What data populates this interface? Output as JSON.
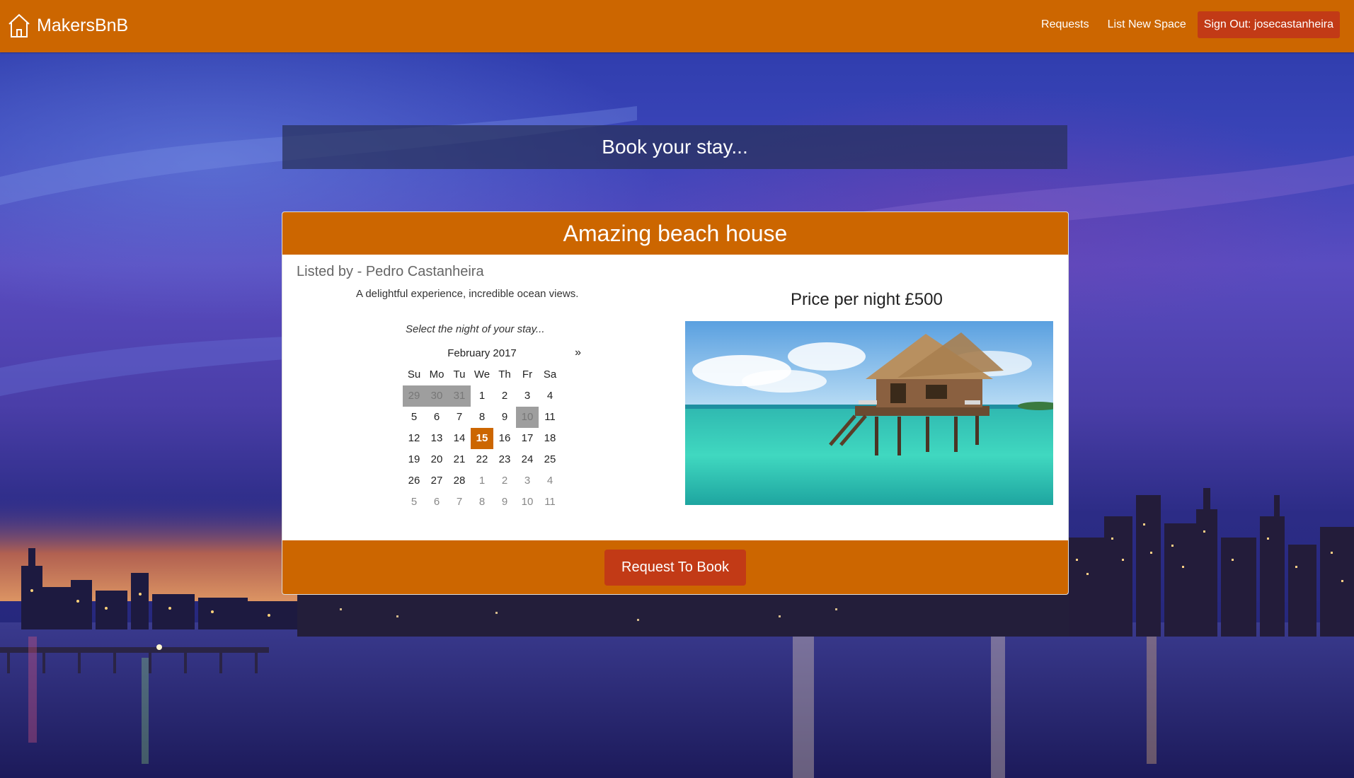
{
  "navbar": {
    "brand": "MakersBnB",
    "links": [
      "Requests",
      "List New Space"
    ],
    "signout_label": "Sign Out: josecastanheira"
  },
  "page": {
    "heading": "Book your stay..."
  },
  "listing": {
    "title": "Amazing beach house",
    "listed_by": "Listed by - Pedro Castanheira",
    "description": "A delightful experience, incredible ocean views.",
    "price_label": "Price per night £500",
    "select_prompt": "Select the night of your stay..."
  },
  "calendar": {
    "month": "February 2017",
    "next": "»",
    "days_of_week": [
      "Su",
      "Mo",
      "Tu",
      "We",
      "Th",
      "Fr",
      "Sa"
    ],
    "weeks": [
      [
        "29",
        "30",
        "31",
        "1",
        "2",
        "3",
        "4"
      ],
      [
        "5",
        "6",
        "7",
        "8",
        "9",
        "10",
        "11"
      ],
      [
        "12",
        "13",
        "14",
        "15",
        "16",
        "17",
        "18"
      ],
      [
        "19",
        "20",
        "21",
        "22",
        "23",
        "24",
        "25"
      ],
      [
        "26",
        "27",
        "28",
        "1",
        "2",
        "3",
        "4"
      ],
      [
        "5",
        "6",
        "7",
        "8",
        "9",
        "10",
        "11"
      ]
    ],
    "disabled": [
      "29",
      "30",
      "31",
      "10"
    ],
    "selected": "15"
  },
  "actions": {
    "book_label": "Request To Book"
  },
  "colors": {
    "primary": "#cc6600",
    "button": "#c23a16"
  },
  "icons": {
    "brand": "house-icon",
    "next_month": "chevron-right-icon"
  }
}
